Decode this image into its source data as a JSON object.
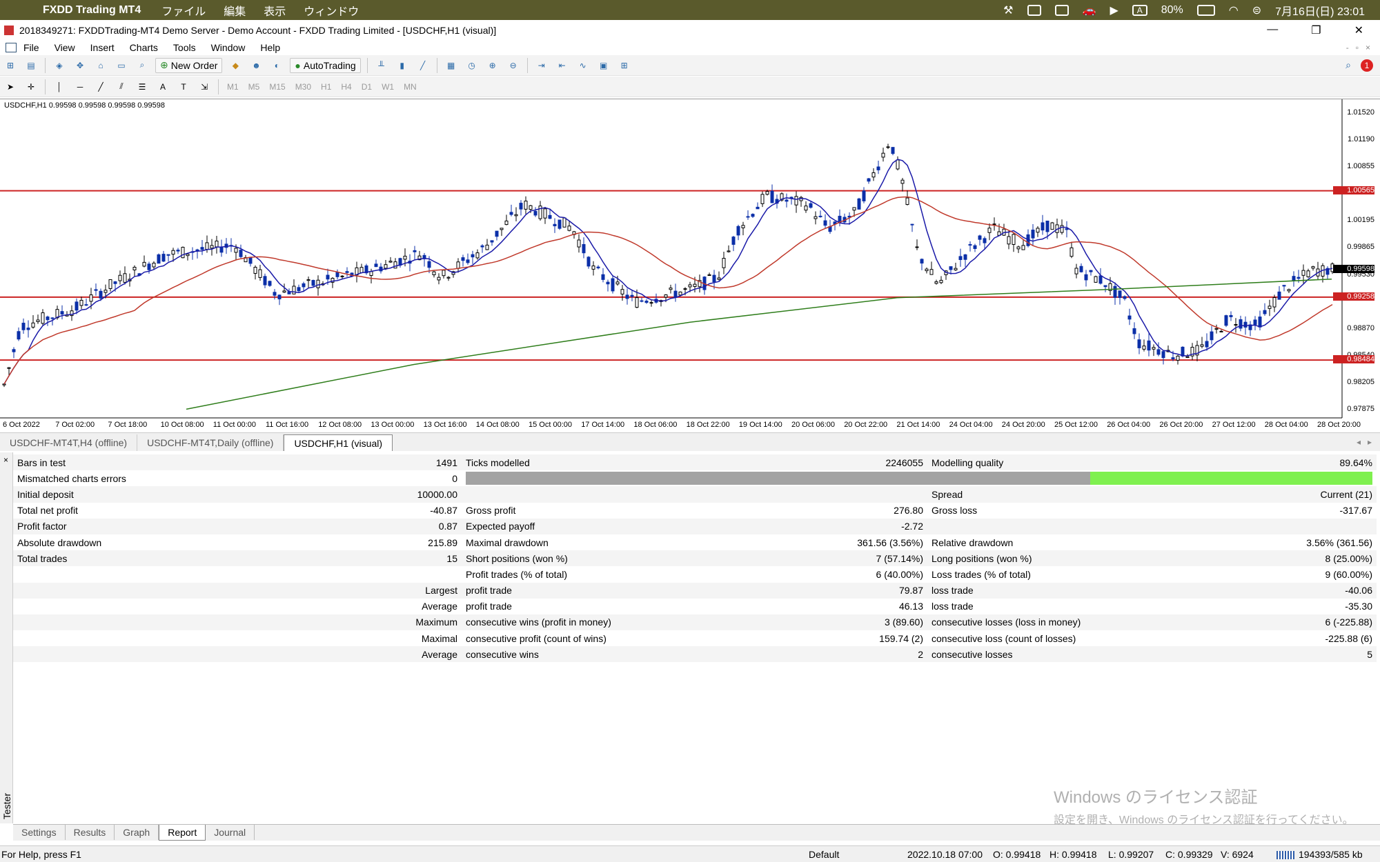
{
  "mac_menu": {
    "app": "FXDD Trading MT4",
    "items": [
      "ファイル",
      "編集",
      "表示",
      "ウィンドウ"
    ],
    "battery": "80%",
    "datetime": "7月16日(日)  23:01"
  },
  "window": {
    "title": "2018349271: FXDDTrading-MT4 Demo Server - Demo Account - FXDD Trading Limited - [USDCHF,H1 (visual)]"
  },
  "menu": [
    "File",
    "View",
    "Insert",
    "Charts",
    "Tools",
    "Window",
    "Help"
  ],
  "toolbar": {
    "new_order": "New Order",
    "autotrading": "AutoTrading",
    "notification_count": "1"
  },
  "timeframes": [
    "M1",
    "M5",
    "M15",
    "M30",
    "H1",
    "H4",
    "D1",
    "W1",
    "MN"
  ],
  "chart": {
    "info": "USDCHF,H1  0.99598 0.99598 0.99598 0.99598",
    "price_labels": [
      "1.01520",
      "1.01190",
      "1.00855",
      "1.00565",
      "1.00195",
      "0.99865",
      "0.99598",
      "0.99530",
      "0.99258",
      "0.98870",
      "0.98540",
      "0.98484",
      "0.98205",
      "0.97875"
    ],
    "hlines": [
      {
        "price": "1.00565",
        "color": "#cc2222"
      },
      {
        "price": "0.99258",
        "color": "#cc2222"
      },
      {
        "price": "0.98484",
        "color": "#cc2222"
      }
    ],
    "current_price": "0.99598",
    "time_labels": [
      "6 Oct 2022",
      "7 Oct 02:00",
      "7 Oct 18:00",
      "10 Oct 08:00",
      "11 Oct 00:00",
      "11 Oct 16:00",
      "12 Oct 08:00",
      "13 Oct 00:00",
      "13 Oct 16:00",
      "14 Oct 08:00",
      "15 Oct 00:00",
      "17 Oct 14:00",
      "18 Oct 06:00",
      "18 Oct 22:00",
      "19 Oct 14:00",
      "20 Oct 06:00",
      "20 Oct 22:00",
      "21 Oct 14:00",
      "24 Oct 04:00",
      "24 Oct 20:00",
      "25 Oct 12:00",
      "26 Oct 04:00",
      "26 Oct 20:00",
      "27 Oct 12:00",
      "28 Oct 04:00",
      "28 Oct 20:00"
    ],
    "colors": {
      "up": "#000000",
      "down": "#0b2fa8",
      "ma_fast": "#1a1aa8",
      "ma_mid": "#c0392b",
      "ma_slow": "#2e7d1a"
    }
  },
  "chart_tabs": [
    "USDCHF-MT4T,H4 (offline)",
    "USDCHF-MT4T,Daily (offline)",
    "USDCHF,H1 (visual)"
  ],
  "report": {
    "rows": [
      [
        "Bars in test",
        "1491",
        "Ticks modelled",
        "2246055",
        "Modelling quality",
        "89.64%"
      ],
      [
        "Mismatched charts errors",
        "0",
        "",
        "",
        "",
        ""
      ],
      [
        "Initial deposit",
        "10000.00",
        "",
        "",
        "Spread",
        "Current (21)"
      ],
      [
        "Total net profit",
        "-40.87",
        "Gross profit",
        "276.80",
        "Gross loss",
        "-317.67"
      ],
      [
        "Profit factor",
        "0.87",
        "Expected payoff",
        "-2.72",
        "",
        ""
      ],
      [
        "Absolute drawdown",
        "215.89",
        "Maximal drawdown",
        "361.56 (3.56%)",
        "Relative drawdown",
        "3.56% (361.56)"
      ],
      [
        "Total trades",
        "15",
        "Short positions (won %)",
        "7 (57.14%)",
        "Long positions (won %)",
        "8 (25.00%)"
      ],
      [
        "",
        "",
        "Profit trades (% of total)",
        "6 (40.00%)",
        "Loss trades (% of total)",
        "9 (60.00%)"
      ],
      [
        "",
        "Largest",
        "profit trade",
        "79.87",
        "loss trade",
        "-40.06"
      ],
      [
        "",
        "Average",
        "profit trade",
        "46.13",
        "loss trade",
        "-35.30"
      ],
      [
        "",
        "Maximum",
        "consecutive wins (profit in money)",
        "3 (89.60)",
        "consecutive losses (loss in money)",
        "6 (-225.88)"
      ],
      [
        "",
        "Maximal",
        "consecutive profit (count of wins)",
        "159.74 (2)",
        "consecutive loss (count of losses)",
        "-225.88 (6)"
      ],
      [
        "",
        "Average",
        "consecutive wins",
        "2",
        "consecutive losses",
        "5"
      ]
    ],
    "modelling_quality_fraction": 0.8964
  },
  "tester_label": "Tester",
  "bottom_tabs": [
    "Settings",
    "Results",
    "Graph",
    "Report",
    "Journal"
  ],
  "watermark": {
    "line1": "Windows のライセンス認証",
    "line2": "設定を開き、Windows のライセンス認証を行ってください。"
  },
  "status": {
    "help": "For Help, press F1",
    "profile": "Default",
    "time": "2022.10.18 07:00",
    "open": "O: 0.99418",
    "high": "H: 0.99418",
    "low": "L: 0.99207",
    "close": "C: 0.99329",
    "volume": "V: 6924",
    "traffic": "194393/585 kb"
  }
}
